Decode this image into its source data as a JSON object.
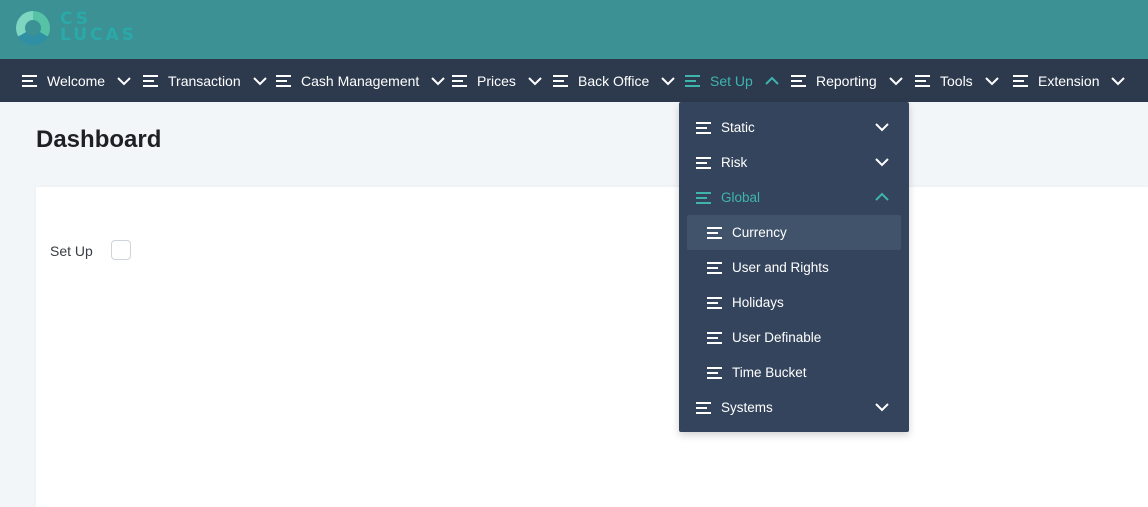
{
  "brand": {
    "line1": "CS",
    "line2": "LUCAS"
  },
  "nav": {
    "items": [
      {
        "label": "Welcome",
        "expanded": false
      },
      {
        "label": "Transaction",
        "expanded": false
      },
      {
        "label": "Cash Management",
        "expanded": false
      },
      {
        "label": "Prices",
        "expanded": false
      },
      {
        "label": "Back Office",
        "expanded": false
      },
      {
        "label": "Set Up",
        "expanded": true
      },
      {
        "label": "Reporting",
        "expanded": false
      },
      {
        "label": "Tools",
        "expanded": false
      },
      {
        "label": "Extension",
        "expanded": false
      }
    ]
  },
  "page": {
    "title": "Dashboard"
  },
  "card": {
    "setup_label": "Set Up",
    "setup_checked": false
  },
  "setup_menu": {
    "items": [
      {
        "label": "Static",
        "expanded": false
      },
      {
        "label": "Risk",
        "expanded": false
      },
      {
        "label": "Global",
        "expanded": true,
        "children": [
          {
            "label": "Currency",
            "selected": true
          },
          {
            "label": "User and Rights"
          },
          {
            "label": "Holidays"
          },
          {
            "label": "User Definable"
          },
          {
            "label": "Time Bucket"
          }
        ]
      },
      {
        "label": "Systems",
        "expanded": false
      }
    ]
  },
  "colors": {
    "header": "#3b9194",
    "navbar": "#2d3a4e",
    "accent": "#3fb4ad",
    "dropdown": "#34445c",
    "selected_row": "#40536b"
  }
}
